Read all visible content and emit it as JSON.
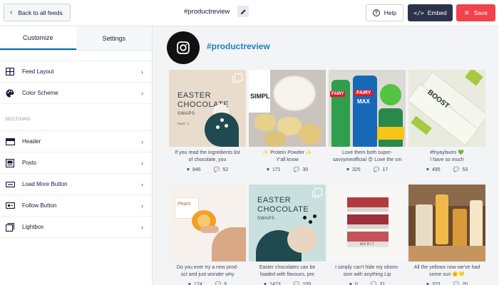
{
  "topbar": {
    "back_label": "Back to all feeds",
    "feed_title": "#productreview",
    "help_label": "Help",
    "embed_label": "Embed",
    "save_label": "Save"
  },
  "sidebar": {
    "tabs": [
      "Customize",
      "Settings"
    ],
    "group1": [
      {
        "label": "Feed Layout",
        "icon": "grid-layout-icon"
      },
      {
        "label": "Color Scheme",
        "icon": "palette-icon"
      }
    ],
    "section_label": "SECTIONS",
    "group2": [
      {
        "label": "Header",
        "icon": "header-icon"
      },
      {
        "label": "Posts",
        "icon": "posts-icon"
      },
      {
        "label": "Load More Button",
        "icon": "load-more-icon"
      },
      {
        "label": "Follow Button",
        "icon": "follow-icon"
      },
      {
        "label": "Lightbox",
        "icon": "lightbox-icon"
      }
    ]
  },
  "profile": {
    "name": "#productreview"
  },
  "posts": [
    {
      "image_text_1": "EASTER",
      "image_text_2": "CHOCOLATE",
      "image_text_3": "SWAPS",
      "image_text_4": "PART 2",
      "caption_1": "If you read the ingredients list",
      "caption_2": "of chocolate, you",
      "likes": "846",
      "comments": "52"
    },
    {
      "image_text_1": "SIMPL",
      "caption_1": "✨ Protein Powder ✨",
      "caption_2": "Y'all know",
      "likes": "171",
      "comments": "30"
    },
    {
      "image_text_1": "FAIRY",
      "image_text_2": "MAX",
      "caption_1": "Love them both super-",
      "caption_2": "savvymeofficial 😍 Love the sm",
      "likes": "325",
      "comments": "17"
    },
    {
      "image_text_1": "BOOST",
      "caption_1": "#friyayfaves 💚",
      "caption_2": "I have so much",
      "likes": "495",
      "comments": "53"
    },
    {
      "image_text_1": "Pears",
      "caption_1": "Do you ever try a new prod-",
      "caption_2": "uct and just wonder why",
      "likes": "174",
      "comments": "6"
    },
    {
      "image_text_1": "EASTER",
      "image_text_2": "CHOCOLATE",
      "image_text_3": "SWAPS",
      "caption_1": "Easter chocolates can be",
      "caption_2": "loaded with flavours, pre",
      "likes": "1473",
      "comments": "109"
    },
    {
      "image_text_1": "MERIT",
      "caption_1": "I simply can't hide my obses-",
      "caption_2": "sion with anything Lip",
      "likes": "0",
      "comments": "31"
    },
    {
      "caption_1": "All the yellows now we've had",
      "caption_2": "some sun 🌞💛",
      "likes": "323",
      "comments": "20"
    }
  ],
  "colors": {
    "accent_blue": "#0068a0",
    "profile_link": "#1e7dc0",
    "embed_bg": "#2c324c",
    "save_bg": "#f0434b"
  }
}
